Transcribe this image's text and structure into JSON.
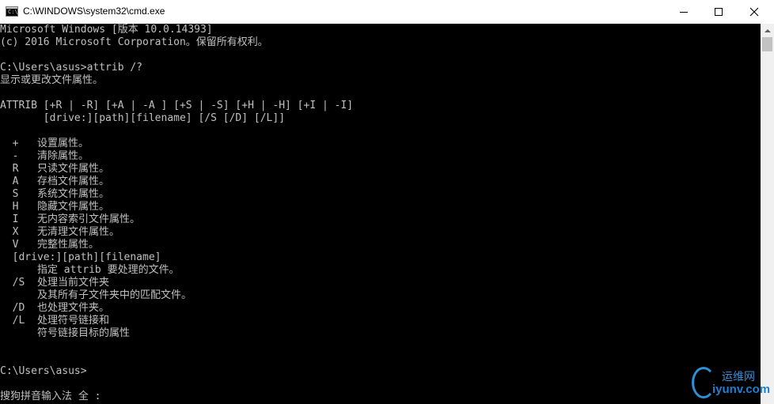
{
  "window": {
    "title": "C:\\WINDOWS\\system32\\cmd.exe",
    "icon": "console-app-icon",
    "controls": [
      "minimize",
      "maximize",
      "close"
    ]
  },
  "console": {
    "lines": [
      "Microsoft Windows [版本 10.0.14393]",
      "(c) 2016 Microsoft Corporation。保留所有权利。",
      "",
      "C:\\Users\\asus>attrib /?",
      "显示或更改文件属性。",
      "",
      "ATTRIB [+R | -R] [+A | -A ] [+S | -S] [+H | -H] [+I | -I]",
      "       [drive:][path][filename] [/S [/D] [/L]]",
      "",
      "  +   设置属性。",
      "  -   清除属性。",
      "  R   只读文件属性。",
      "  A   存档文件属性。",
      "  S   系统文件属性。",
      "  H   隐藏文件属性。",
      "  I   无内容索引文件属性。",
      "  X   无清理文件属性。",
      "  V   完整性属性。",
      "  [drive:][path][filename]",
      "      指定 attrib 要处理的文件。",
      "  /S  处理当前文件夹",
      "      及其所有子文件夹中的匹配文件。",
      "  /D  也处理文件夹。",
      "  /L  处理符号链接和",
      "      符号链接目标的属性",
      "",
      "",
      "C:\\Users\\asus>",
      "",
      "搜狗拼音输入法 全 :"
    ]
  },
  "watermark": {
    "cn": "运维网",
    "en": "iyunv.com"
  }
}
